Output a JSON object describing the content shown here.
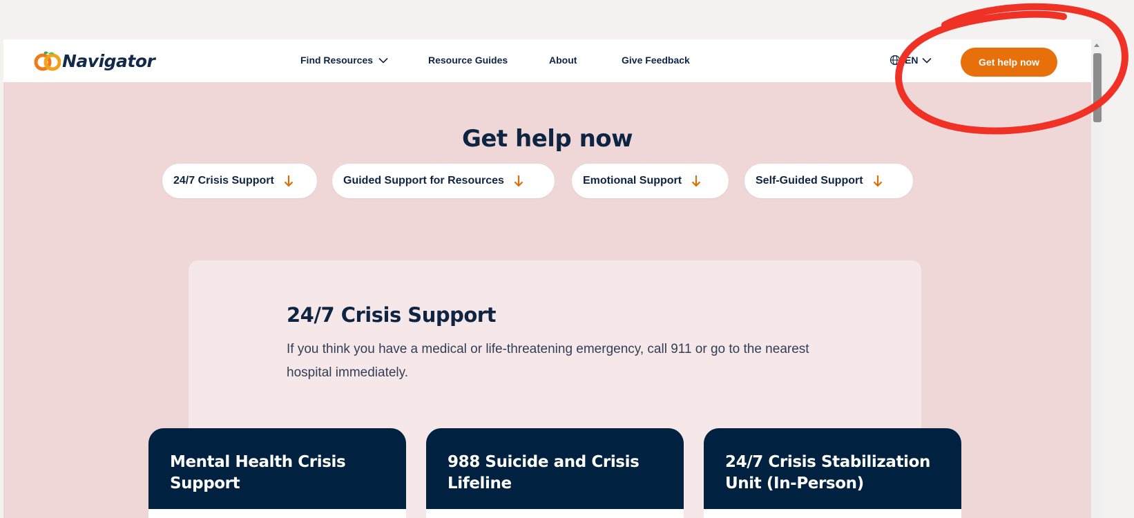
{
  "header": {
    "logo_text": "Navigator",
    "nav": [
      {
        "label": "Find Resources",
        "has_dropdown": true
      },
      {
        "label": "Resource Guides"
      },
      {
        "label": "About"
      },
      {
        "label": "Give Feedback"
      }
    ],
    "language": "EN",
    "cta_label": "Get help now"
  },
  "hero": {
    "title": "Get help now",
    "quick_links": [
      "24/7 Crisis Support",
      "Guided Support for Resources",
      "Emotional Support",
      "Self-Guided Support"
    ]
  },
  "crisis_section": {
    "title": "24/7 Crisis Support",
    "description": "If you think you have a medical or life-threatening emergency, call 911 or go to the nearest hospital immediately.",
    "cards": [
      {
        "title": "Mental Health Crisis Support"
      },
      {
        "title": "988 Suicide and Crisis Lifeline"
      },
      {
        "title": "24/7 Crisis Stabilization Unit (In-Person)"
      }
    ]
  },
  "colors": {
    "accent_orange": "#e8700b",
    "navy": "#0e2443",
    "card_navy": "#00213f",
    "page_pink": "#efd7d7",
    "panel_pink": "#f6e8e8",
    "annotation_red": "#f03226"
  },
  "icons": [
    "chevron-down-icon",
    "globe-icon",
    "arrow-down-icon",
    "scroll-up-icon"
  ]
}
